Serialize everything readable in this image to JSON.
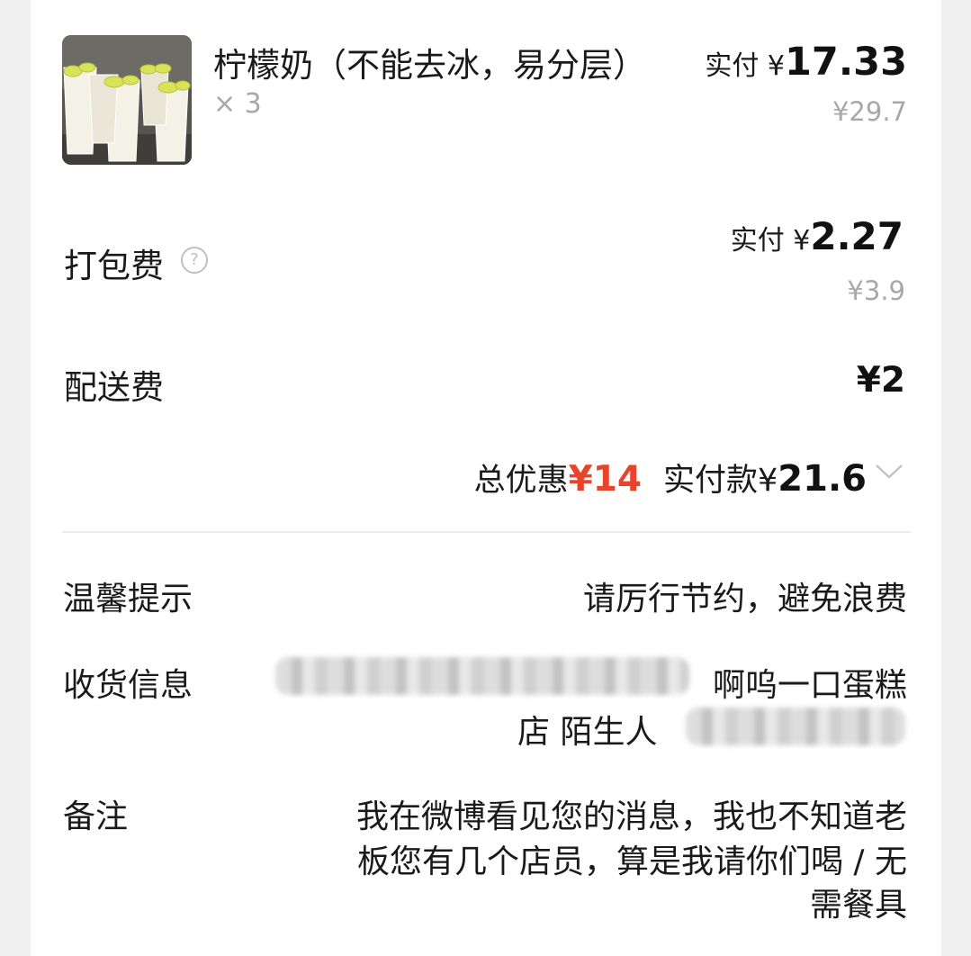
{
  "product": {
    "name": "柠檬奶（不能去冰，易分层）",
    "quantity": "× 3",
    "paid_label": "实付 ¥",
    "paid_amount": "17.33",
    "original_price": "¥29.7"
  },
  "packaging_fee": {
    "label": "打包费",
    "help_icon": "question-circle-icon",
    "paid_label": "实付 ¥",
    "paid_amount": "2.27",
    "original_price": "¥3.9"
  },
  "delivery_fee": {
    "label": "配送费",
    "amount": "¥2"
  },
  "summary": {
    "discount_label": "总优惠",
    "discount_amount": "¥14",
    "paid_label": "实付款",
    "paid_currency": "¥",
    "paid_amount": "21.6",
    "expand_icon": "chevron-down-icon",
    "discount_color": "#e8442c"
  },
  "info": {
    "tip": {
      "label": "温馨提示",
      "value": "请厉行节约，避免浪费"
    },
    "shipping": {
      "label": "收货信息",
      "line1_visible": "啊呜一口蛋糕",
      "line2_visible": "店 陌生人"
    },
    "note": {
      "label": "备注",
      "line1": "我在微博看见您的消息，我也不知道老",
      "line2": "板您有几个店员，算是我请你们喝 / 无",
      "line3": "需餐具"
    }
  }
}
